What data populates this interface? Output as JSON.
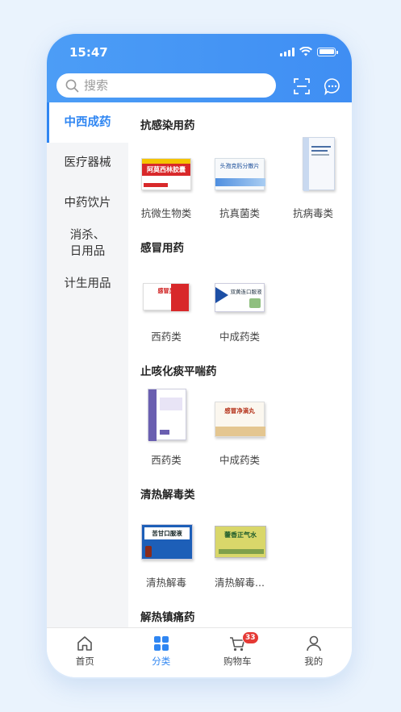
{
  "status_bar": {
    "time": "15:47"
  },
  "search": {
    "placeholder": "搜索"
  },
  "sidebar": {
    "items": [
      {
        "label": "中西成药"
      },
      {
        "label": "医疗器械"
      },
      {
        "label": "中药饮片"
      },
      {
        "label": "消杀、日用品"
      },
      {
        "label": "计生用品"
      }
    ]
  },
  "sections": [
    {
      "title": "抗感染用药",
      "products": [
        {
          "label": "抗微生物类",
          "box_text": "阿莫西林胶囊",
          "icon": "medicine-box-red"
        },
        {
          "label": "抗真菌类",
          "box_text": "头孢克肟分散片",
          "icon": "medicine-box-blue"
        },
        {
          "label": "抗病毒类",
          "icon": "medicine-box-tall"
        }
      ]
    },
    {
      "title": "感冒用药",
      "products": [
        {
          "label": "西药类",
          "box_text": "感冒灵",
          "icon": "medicine-box-red"
        },
        {
          "label": "中成药类",
          "box_text": "双黄连口服液",
          "icon": "medicine-box-blue"
        }
      ]
    },
    {
      "title": "止咳化痰平喘药",
      "products": [
        {
          "label": "西药类",
          "icon": "medicine-box-purple"
        },
        {
          "label": "中成药类",
          "box_text": "感冒净滴丸",
          "icon": "medicine-box-orange"
        }
      ]
    },
    {
      "title": "清热解毒类",
      "products": [
        {
          "label": "清热解毒",
          "box_text": "苦甘口服液",
          "icon": "medicine-box-blue"
        },
        {
          "label": "清热解毒...",
          "box_text": "藿香正气水",
          "icon": "medicine-box-green"
        }
      ]
    },
    {
      "title": "解热镇痛药",
      "products": []
    }
  ],
  "tabbar": {
    "items": [
      {
        "label": "首页",
        "icon": "home-icon"
      },
      {
        "label": "分类",
        "icon": "category-icon"
      },
      {
        "label": "购物车",
        "icon": "cart-icon",
        "badge": "33"
      },
      {
        "label": "我的",
        "icon": "user-icon"
      }
    ]
  },
  "colors": {
    "accent": "#2f86f2",
    "header": "#4593f4",
    "badge": "#e53935"
  }
}
